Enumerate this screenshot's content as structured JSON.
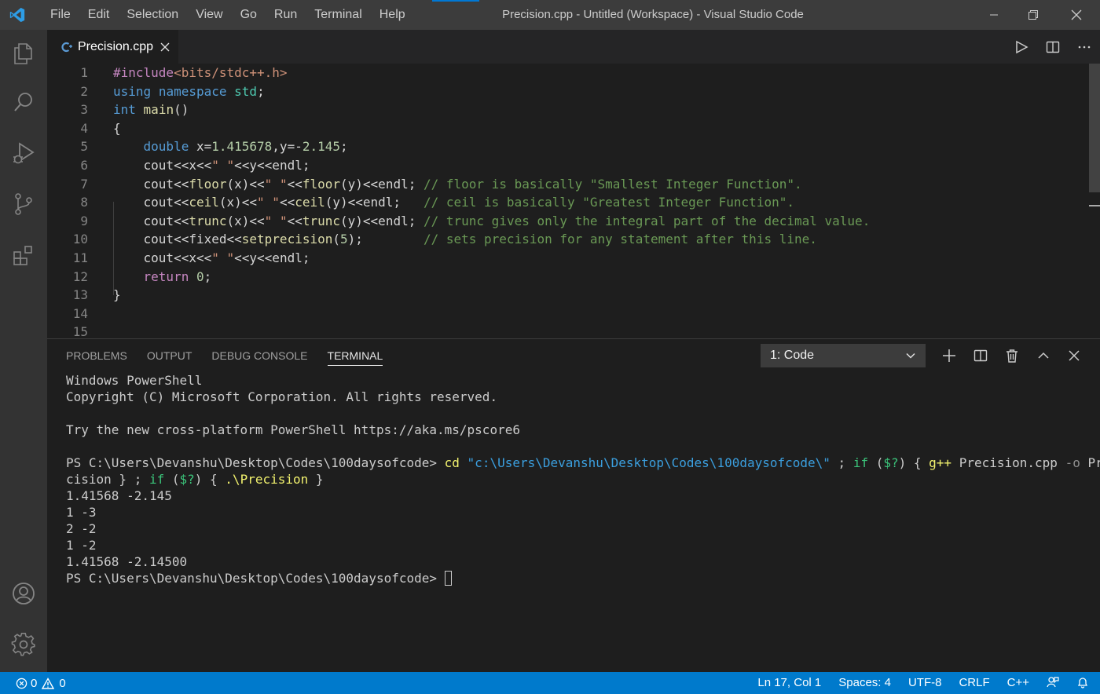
{
  "window": {
    "title": "Precision.cpp - Untitled (Workspace) - Visual Studio Code",
    "menu": [
      "File",
      "Edit",
      "Selection",
      "View",
      "Go",
      "Run",
      "Terminal",
      "Help"
    ]
  },
  "tab": {
    "filename": "Precision.cpp",
    "icon": "cpp-file-icon"
  },
  "editor": {
    "line_numbers": [
      "1",
      "2",
      "3",
      "4",
      "5",
      "6",
      "7",
      "8",
      "9",
      "10",
      "11",
      "12",
      "13",
      "14",
      "15"
    ],
    "lines": [
      [
        [
          "k-pre",
          "#include"
        ],
        [
          "k-str",
          "<bits/stdc++.h>"
        ]
      ],
      [
        [
          "k-key",
          "using"
        ],
        [
          "k-txt",
          " "
        ],
        [
          "k-key",
          "namespace"
        ],
        [
          "k-txt",
          " "
        ],
        [
          "k-ns",
          "std"
        ],
        [
          "k-txt",
          ";"
        ]
      ],
      [
        [
          "k-key",
          "int"
        ],
        [
          "k-txt",
          " "
        ],
        [
          "k-fn",
          "main"
        ],
        [
          "k-txt",
          "()"
        ]
      ],
      [
        [
          "k-txt",
          "{"
        ]
      ],
      [
        [
          "k-txt",
          "    "
        ],
        [
          "k-key",
          "double"
        ],
        [
          "k-txt",
          " x="
        ],
        [
          "k-num",
          "1.415678"
        ],
        [
          "k-txt",
          ",y=-"
        ],
        [
          "k-num",
          "2.145"
        ],
        [
          "k-txt",
          ";"
        ]
      ],
      [
        [
          "k-txt",
          "    cout<<x<<"
        ],
        [
          "k-str",
          "\" \""
        ],
        [
          "k-txt",
          "<<y<<endl;"
        ]
      ],
      [
        [
          "k-txt",
          "    cout<<"
        ],
        [
          "k-fn",
          "floor"
        ],
        [
          "k-txt",
          "(x)<<"
        ],
        [
          "k-str",
          "\" \""
        ],
        [
          "k-txt",
          "<<"
        ],
        [
          "k-fn",
          "floor"
        ],
        [
          "k-txt",
          "(y)<<endl; "
        ],
        [
          "k-cmt",
          "// floor is basically \"Smallest Integer Function\"."
        ]
      ],
      [
        [
          "k-txt",
          "    cout<<"
        ],
        [
          "k-fn",
          "ceil"
        ],
        [
          "k-txt",
          "(x)<<"
        ],
        [
          "k-str",
          "\" \""
        ],
        [
          "k-txt",
          "<<"
        ],
        [
          "k-fn",
          "ceil"
        ],
        [
          "k-txt",
          "(y)<<endl;   "
        ],
        [
          "k-cmt",
          "// ceil is basically \"Greatest Integer Function\"."
        ]
      ],
      [
        [
          "k-txt",
          "    cout<<"
        ],
        [
          "k-fn",
          "trunc"
        ],
        [
          "k-txt",
          "(x)<<"
        ],
        [
          "k-str",
          "\" \""
        ],
        [
          "k-txt",
          "<<"
        ],
        [
          "k-fn",
          "trunc"
        ],
        [
          "k-txt",
          "(y)<<endl; "
        ],
        [
          "k-cmt",
          "// trunc gives only the integral part of the decimal value."
        ]
      ],
      [
        [
          "k-txt",
          "    cout<<fixed<<"
        ],
        [
          "k-fn",
          "setprecision"
        ],
        [
          "k-txt",
          "("
        ],
        [
          "k-num",
          "5"
        ],
        [
          "k-txt",
          ");        "
        ],
        [
          "k-cmt",
          "// sets precision for any statement after this line."
        ]
      ],
      [
        [
          "k-txt",
          "    cout<<x<<"
        ],
        [
          "k-str",
          "\" \""
        ],
        [
          "k-txt",
          "<<y<<endl;"
        ]
      ],
      [
        [
          "k-txt",
          "    "
        ],
        [
          "k-ctl",
          "return"
        ],
        [
          "k-txt",
          " "
        ],
        [
          "k-num",
          "0"
        ],
        [
          "k-txt",
          ";"
        ]
      ],
      [
        [
          "k-txt",
          "}"
        ]
      ],
      [],
      []
    ]
  },
  "panel": {
    "tabs": [
      "PROBLEMS",
      "OUTPUT",
      "DEBUG CONSOLE",
      "TERMINAL"
    ],
    "active_tab": "TERMINAL",
    "terminal_select": "1: Code",
    "terminal_lines": [
      [
        [
          "",
          "Windows PowerShell"
        ]
      ],
      [
        [
          "",
          "Copyright (C) Microsoft Corporation. All rights reserved."
        ]
      ],
      [],
      [
        [
          "",
          "Try the new cross-platform PowerShell https://aka.ms/pscore6"
        ]
      ],
      [],
      [
        [
          "",
          "PS C:\\Users\\Devanshu\\Desktop\\Codes\\100daysofcode> "
        ],
        [
          "t-cmd",
          "cd"
        ],
        [
          "",
          " "
        ],
        [
          "t-str",
          "\"c:\\Users\\Devanshu\\Desktop\\Codes\\100daysofcode\\\""
        ],
        [
          "",
          " ; "
        ],
        [
          "t-kw",
          "if"
        ],
        [
          "",
          " ("
        ],
        [
          "t-kw",
          "$?"
        ],
        [
          "",
          ") { "
        ],
        [
          "t-cmd",
          "g++"
        ],
        [
          "",
          " Precision.cpp "
        ],
        [
          "t-flag",
          "-o"
        ],
        [
          "",
          " Pre"
        ]
      ],
      [
        [
          "",
          "cision } ; "
        ],
        [
          "t-kw",
          "if"
        ],
        [
          "",
          " ("
        ],
        [
          "t-kw",
          "$?"
        ],
        [
          "",
          ") { "
        ],
        [
          "t-yel",
          ".\\Precision"
        ],
        [
          "",
          " }"
        ]
      ],
      [
        [
          "",
          "1.41568 -2.145"
        ]
      ],
      [
        [
          "",
          "1 -3"
        ]
      ],
      [
        [
          "",
          "2 -2"
        ]
      ],
      [
        [
          "",
          "1 -2"
        ]
      ],
      [
        [
          "",
          "1.41568 -2.14500"
        ]
      ],
      [
        [
          "",
          "PS C:\\Users\\Devanshu\\Desktop\\Codes\\100daysofcode> "
        ]
      ]
    ]
  },
  "statusbar": {
    "errors": "0",
    "warnings": "0",
    "position": "Ln 17, Col 1",
    "spaces": "Spaces: 4",
    "encoding": "UTF-8",
    "eol": "CRLF",
    "language": "C++"
  },
  "colors": {
    "accent": "#007acc",
    "titlebar": "#3c3c3c",
    "activitybar": "#333333",
    "editor_bg": "#1e1e1e"
  }
}
